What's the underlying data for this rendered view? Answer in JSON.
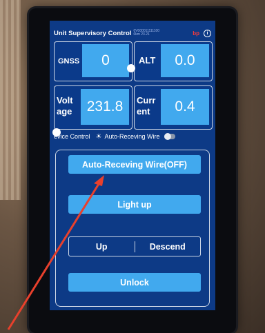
{
  "header": {
    "title": "Unit Supervisory Control",
    "subtitle": "0V0000111111000km\n23.21",
    "badge": "bp",
    "info_icon": "info-icon"
  },
  "tiles": {
    "gnss": {
      "label": "GNSS",
      "value": "0"
    },
    "alt": {
      "label": "ALT",
      "value": "0.0"
    },
    "voltage": {
      "label_line1": "Volt",
      "label_line2": "age",
      "value": "231.8"
    },
    "current": {
      "label_line1": "Curr",
      "label_line2": "ent",
      "value": "0.4"
    }
  },
  "control_row": {
    "device_control": "evice Control",
    "auto_receiving": "Auto-Receving Wire",
    "icon": "sun-icon"
  },
  "panel": {
    "auto_button": "Auto-Receving Wire(OFF)",
    "light_button": "Light up",
    "up_button": "Up",
    "descend_button": "Descend",
    "unlock_button": "Unlock"
  },
  "colors": {
    "screen_bg": "#0d3a86",
    "accent": "#41a9ee",
    "annotation_arrow": "#e8402c"
  }
}
